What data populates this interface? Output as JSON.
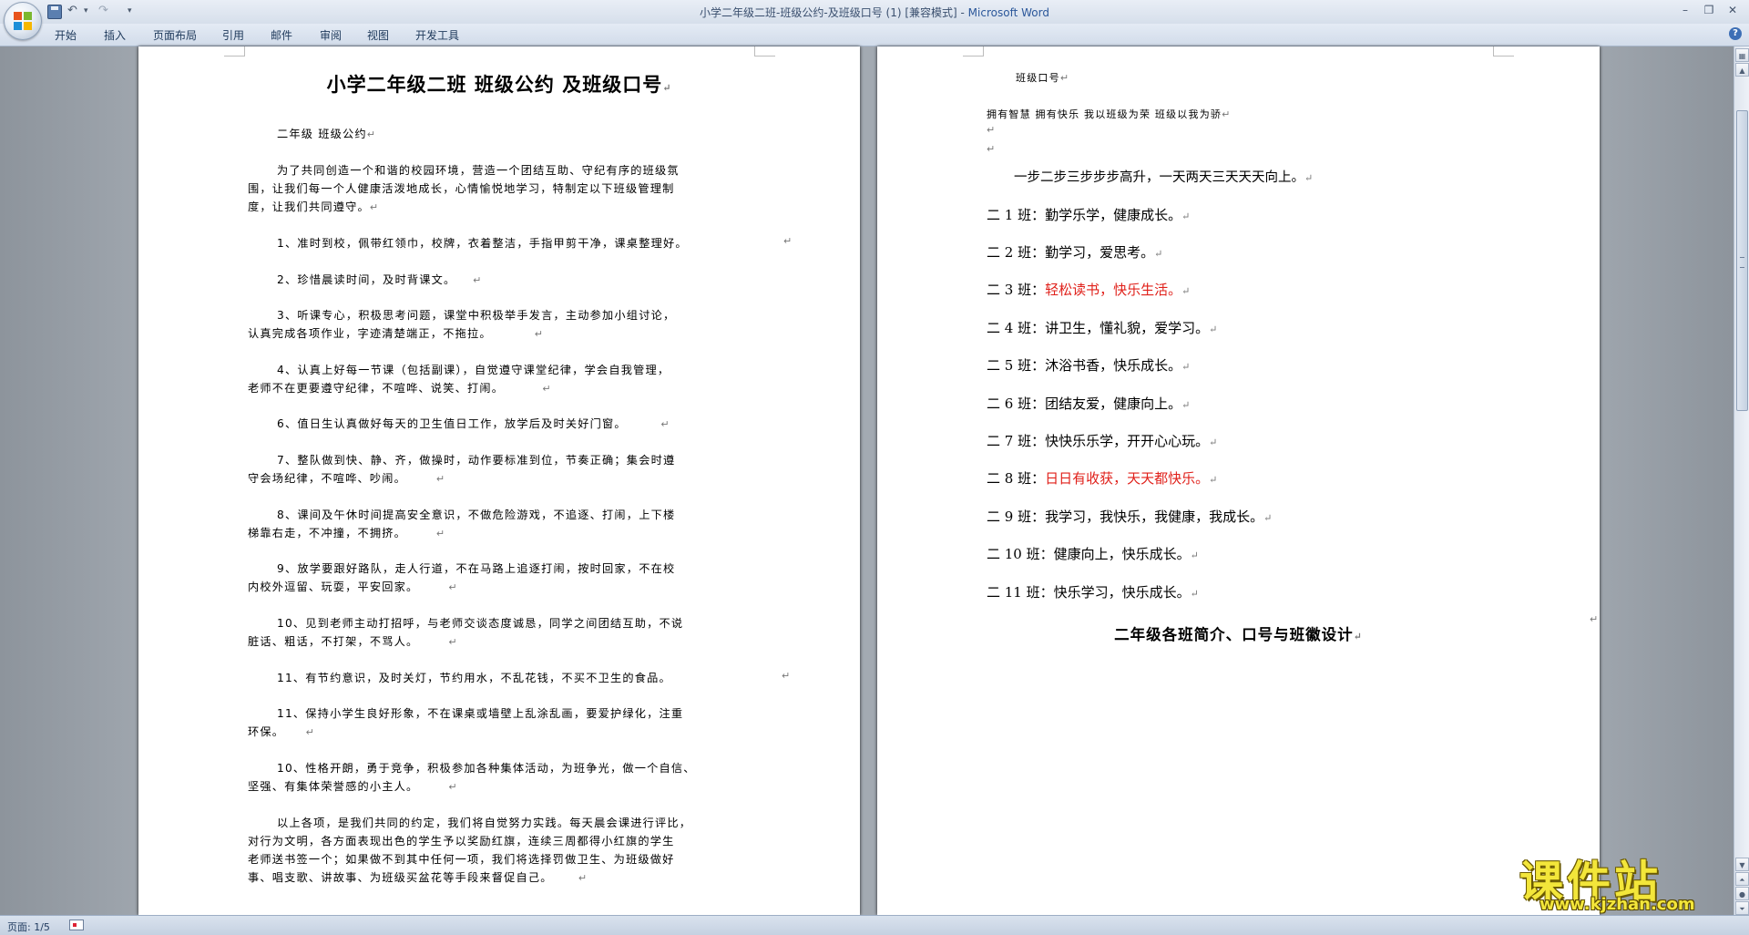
{
  "window": {
    "title_doc": "小学二年级二班-班级公约-及班级口号 (1) [兼容模式] - ",
    "title_app": "Microsoft Word"
  },
  "ribbon": {
    "tabs": [
      "开始",
      "插入",
      "页面布局",
      "引用",
      "邮件",
      "审阅",
      "视图",
      "开发工具"
    ]
  },
  "left_page": {
    "title": "小学二年级二班  班级公约  及班级口号",
    "subtitle": "二年级 班级公约",
    "lines": [
      "为了共同创造一个和谐的校园环境，营造一个团结互助、守纪有序的班级氛",
      "围，让我们每一个人健康活泼地成长，心情愉悦地学习，特制定以下班级管理制",
      "度，让我们共同遵守。",
      "1、准时到校，佩带红领巾，校牌，衣着整洁，手指甲剪干净，课桌整理好。",
      "2、珍惜晨读时间，及时背课文。",
      "3、听课专心，积极思考问题，课堂中积极举手发言，主动参加小组讨论，",
      "认真完成各项作业，字迹清楚端正，不拖拉。",
      "4、认真上好每一节课（包括副课），自觉遵守课堂纪律，学会自我管理，",
      "老师不在更要遵守纪律，不喧哗、说笑、打闹。",
      "6、值日生认真做好每天的卫生值日工作，放学后及时关好门窗。",
      "7、整队做到快、静、齐，做操时，动作要标准到位，节奏正确；集会时遵",
      "守会场纪律，不喧哗、吵闹。",
      "8、课间及午休时间提高安全意识，不做危险游戏，不追逐、打闹，上下楼",
      "梯靠右走，不冲撞，不拥挤。",
      "9、放学要跟好路队，走人行道，不在马路上追逐打闹，按时回家，不在校",
      "内校外逗留、玩耍，平安回家。",
      "10、见到老师主动打招呼，与老师交谈态度诚恳，同学之间团结互助，不说",
      "脏话、粗话，不打架，不骂人。",
      "11、有节约意识，及时关灯，节约用水，不乱花钱，不买不卫生的食品。",
      "11、保持小学生良好形象，不在课桌或墙壁上乱涂乱画，要爱护绿化，注重",
      "环保。",
      "10、性格开朗，勇于竞争，积极参加各种集体活动，为班争光，做一个自信、",
      "坚强、有集体荣誉感的小主人。",
      "以上各项，是我们共同的约定，我们将自觉努力实践。每天晨会课进行评比，",
      "对行为文明，各方面表现出色的学生予以奖励红旗，连续三周都得小红旗的学生",
      "老师送书签一个；如果做不到其中任何一项，我们将选择罚做卫生、为班级做好",
      "事、唱支歌、讲故事、为班级买盆花等手段来督促自己。"
    ]
  },
  "right_page": {
    "heading": "班级口号",
    "slogan": "拥有智慧    拥有快乐    我以班级为荣    班级以我为骄",
    "intro": "一步二步三步步步高升，一天两天三天天天向上。",
    "classes": [
      {
        "prefix": "二 1 班：",
        "text": "勤学乐学，健康成长。",
        "color": "#000000"
      },
      {
        "prefix": "二 2 班：",
        "text": "勤学习，爱思考。",
        "color": "#000000"
      },
      {
        "prefix": "二 3 班：",
        "text": "轻松读书，快乐生活。",
        "color": "#e0201a"
      },
      {
        "prefix": "二 4 班：",
        "text": "讲卫生，懂礼貌，爱学习。",
        "color": "#000000"
      },
      {
        "prefix": "二 5 班：",
        "text": "沐浴书香，快乐成长。",
        "color": "#000000"
      },
      {
        "prefix": "二 6 班：",
        "text": "团结友爱，健康向上。",
        "color": "#000000"
      },
      {
        "prefix": "二 7 班：",
        "text": "快快乐乐学，开开心心玩。",
        "color": "#000000"
      },
      {
        "prefix": "二 8 班：",
        "text": "日日有收获，天天都快乐。",
        "color": "#e0201a"
      },
      {
        "prefix": "二 9 班：",
        "text": "我学习，我快乐，我健康，我成长。",
        "color": "#000000"
      },
      {
        "prefix": "二 10 班：",
        "text": "健康向上，快乐成长。",
        "color": "#000000"
      },
      {
        "prefix": "二 11 班：",
        "text": "快乐学习，快乐成长。",
        "color": "#000000"
      }
    ],
    "bottom_heading": "二年级各班简介、口号与班徽设计"
  },
  "status": {
    "page": "页面: 1/5"
  },
  "watermark": {
    "big": "课件站",
    "small": "www.kjzhan.com"
  }
}
